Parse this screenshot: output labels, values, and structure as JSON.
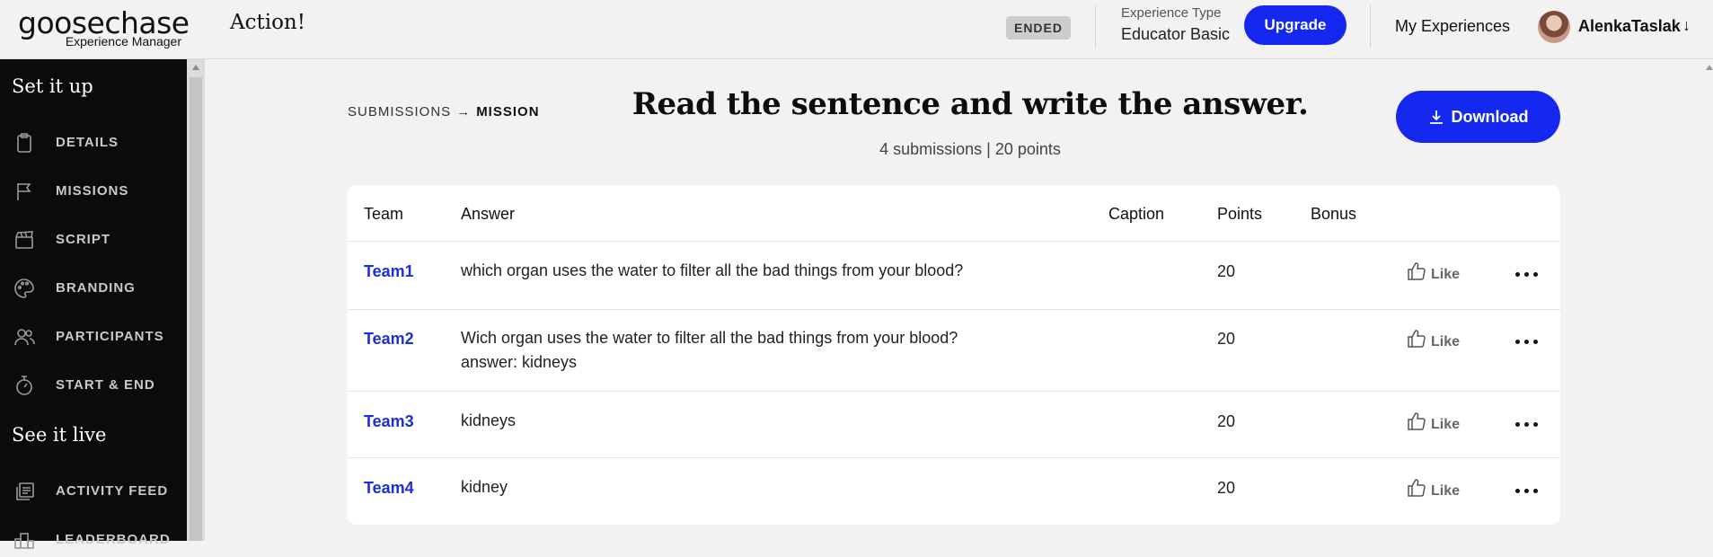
{
  "header": {
    "logo_main": "goosechase",
    "logo_sub": "Experience Manager",
    "experience_title": "Action!",
    "status_badge": "ENDED",
    "experience_type_label": "Experience Type",
    "experience_type_value": "Educator Basic",
    "upgrade_label": "Upgrade",
    "my_experiences_label": "My Experiences",
    "username": "AlenkaTaslak",
    "user_menu_icon": "arrow-down-icon"
  },
  "sidebar": {
    "section1_heading": "Set it up",
    "section1_items": [
      {
        "label": "DETAILS",
        "icon": "clipboard-icon"
      },
      {
        "label": "MISSIONS",
        "icon": "flag-icon"
      },
      {
        "label": "SCRIPT",
        "icon": "clapperboard-icon"
      },
      {
        "label": "BRANDING",
        "icon": "palette-icon"
      },
      {
        "label": "PARTICIPANTS",
        "icon": "users-icon"
      },
      {
        "label": "START & END",
        "icon": "stopwatch-icon"
      }
    ],
    "section2_heading": "See it live",
    "section2_items": [
      {
        "label": "ACTIVITY FEED",
        "icon": "stack-icon"
      },
      {
        "label": "LEADERBOARD",
        "icon": "podium-icon"
      }
    ]
  },
  "main": {
    "breadcrumb": {
      "parent": "SUBMISSIONS",
      "current": "MISSION"
    },
    "title": "Read the sentence and write the answer.",
    "meta": "4 submissions | 20 points",
    "download_label": "Download",
    "table": {
      "headers": {
        "team": "Team",
        "answer": "Answer",
        "caption": "Caption",
        "points": "Points",
        "bonus": "Bonus"
      },
      "like_label": "Like",
      "rows": [
        {
          "team": "Team1",
          "answer": "which organ uses the water to filter all the bad things from your blood?",
          "points": "20"
        },
        {
          "team": "Team2",
          "answer": "Wich organ uses the water to filter all the bad things from your blood?\nanswer: kidneys",
          "points": "20"
        },
        {
          "team": "Team3",
          "answer": "kidneys",
          "points": "20"
        },
        {
          "team": "Team4",
          "answer": "kidney",
          "points": "20"
        }
      ]
    }
  },
  "colors": {
    "accent": "#1428f0",
    "team_link": "#1d2fd8",
    "sidebar_bg": "#0b0b0b",
    "page_bg": "#f3f1f1"
  }
}
